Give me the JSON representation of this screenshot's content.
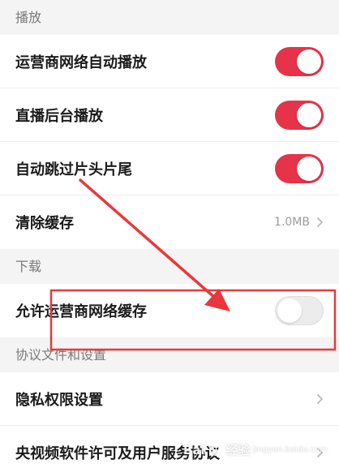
{
  "sections": {
    "playback": {
      "title": "播放",
      "items": [
        {
          "label": "运营商网络自动播放",
          "toggle": "on"
        },
        {
          "label": "直播后台播放",
          "toggle": "on"
        },
        {
          "label": "自动跳过片头片尾",
          "toggle": "on"
        },
        {
          "label": "清除缓存",
          "value": "1.0MB"
        }
      ]
    },
    "download": {
      "title": "下载",
      "items": [
        {
          "label": "允许运营商网络缓存",
          "toggle": "off"
        }
      ]
    },
    "agreements": {
      "title": "协议文件和设置",
      "items": [
        {
          "label": "隐私权限设置"
        },
        {
          "label": "央视频软件许可及用户服务协议"
        }
      ]
    }
  },
  "colors": {
    "toggle_on": "#e5334a",
    "toggle_off": "#ececec",
    "annotation": "#e8383d"
  },
  "watermark": {
    "brand": "Bai",
    "brand_suffix": "经验",
    "sub": "jingyan.baidu.com"
  }
}
